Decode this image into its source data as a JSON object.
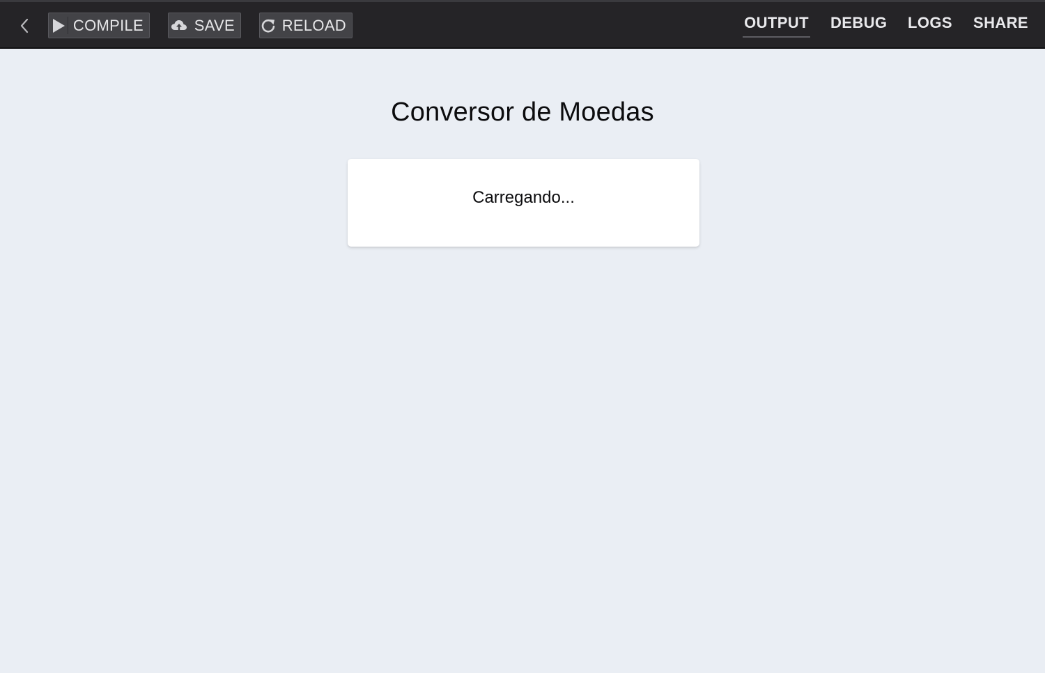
{
  "toolbar": {
    "back_icon": "chevron-left-icon",
    "compile": {
      "label": "COMPILE",
      "icon": "play-icon"
    },
    "save": {
      "label": "SAVE",
      "icon": "cloud-upload-icon"
    },
    "reload": {
      "label": "RELOAD",
      "icon": "reload-icon"
    }
  },
  "tabs": [
    {
      "label": "OUTPUT",
      "active": true
    },
    {
      "label": "DEBUG",
      "active": false
    },
    {
      "label": "LOGS",
      "active": false
    },
    {
      "label": "SHARE",
      "active": false
    }
  ],
  "main": {
    "title": "Conversor de Moedas",
    "loading_text": "Carregando..."
  },
  "colors": {
    "topbar_bg": "#252427",
    "page_bg": "#eaeef4",
    "button_bg": "#434347",
    "card_bg": "#ffffff"
  }
}
